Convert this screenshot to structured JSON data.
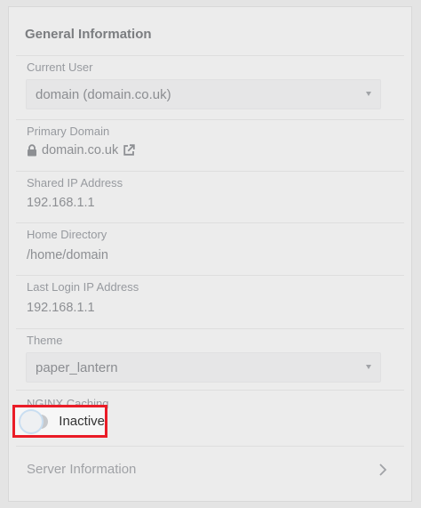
{
  "panel": {
    "title": "General Information"
  },
  "current_user": {
    "label": "Current User",
    "value": "domain (domain.co.uk)"
  },
  "primary_domain": {
    "label": "Primary Domain",
    "value": "domain.co.uk"
  },
  "shared_ip": {
    "label": "Shared IP Address",
    "value": "192.168.1.1"
  },
  "home_directory": {
    "label": "Home Directory",
    "value": "/home/domain"
  },
  "last_login_ip": {
    "label": "Last Login IP Address",
    "value": "192.168.1.1"
  },
  "theme": {
    "label": "Theme",
    "value": "paper_lantern"
  },
  "nginx_caching": {
    "label": "NGINX Caching",
    "status": "Inactive",
    "enabled": false,
    "highlight_color": "#ea1c27"
  },
  "server_information": {
    "label": "Server Information"
  },
  "icons": {
    "lock": "lock-icon",
    "external_link": "external-link-icon",
    "dropdown": "caret-down-icon",
    "chevron": "chevron-right-icon"
  }
}
